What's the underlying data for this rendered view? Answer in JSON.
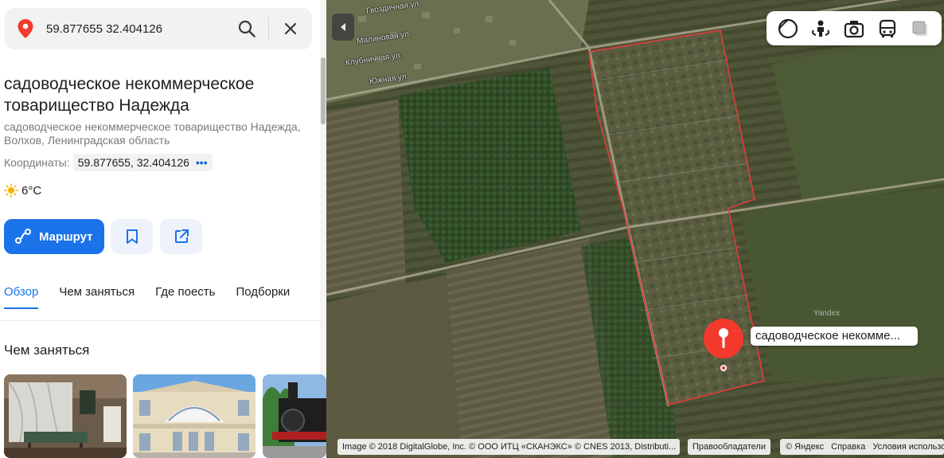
{
  "search": {
    "query": "59.877655 32.404126",
    "pin_icon": "location-pin-icon",
    "search_icon": "search-icon",
    "close_icon": "close-icon"
  },
  "place": {
    "title": "садоводческое некоммерческое товарищество Надежда",
    "address": "садоводческое некоммерческое товарищество Надежда, Волхов, Ленинградская область",
    "coords_label": "Координаты:",
    "coords_value": "59.877655, 32.404126",
    "coords_more": "•••",
    "weather": "6°C"
  },
  "actions": {
    "route_label": "Маршрут",
    "bookmark_icon": "bookmark-icon",
    "share_icon": "share-icon"
  },
  "tabs": [
    {
      "label": "Обзор",
      "active": true
    },
    {
      "label": "Чем заняться",
      "active": false
    },
    {
      "label": "Где поесть",
      "active": false
    },
    {
      "label": "Подборки",
      "active": false
    }
  ],
  "section": {
    "title": "Чем заняться"
  },
  "map": {
    "layers": [
      "layers-icon",
      "panorama-icon",
      "photo-icon",
      "transit-icon",
      "traffic-icon"
    ],
    "marker_label": "садоводческое некомме...",
    "streets": [
      "Гвоздичная ул.",
      "Малиновая ул.",
      "Клубничная ул.",
      "Южная ул."
    ],
    "watermark": "Yandex",
    "attribution": "Image © 2018 DigitalGlobe, Inc. © ООО ИТЦ «СКАНЭКС» © CNES 2013, Distributi...",
    "rights_holders": "Правообладатели",
    "links": [
      "© Яндекс",
      "Справка",
      "Условия использо..."
    ]
  },
  "colors": {
    "accent": "#1a73e8",
    "marker": "#f33a2c",
    "boundary": "#e23b3b"
  }
}
